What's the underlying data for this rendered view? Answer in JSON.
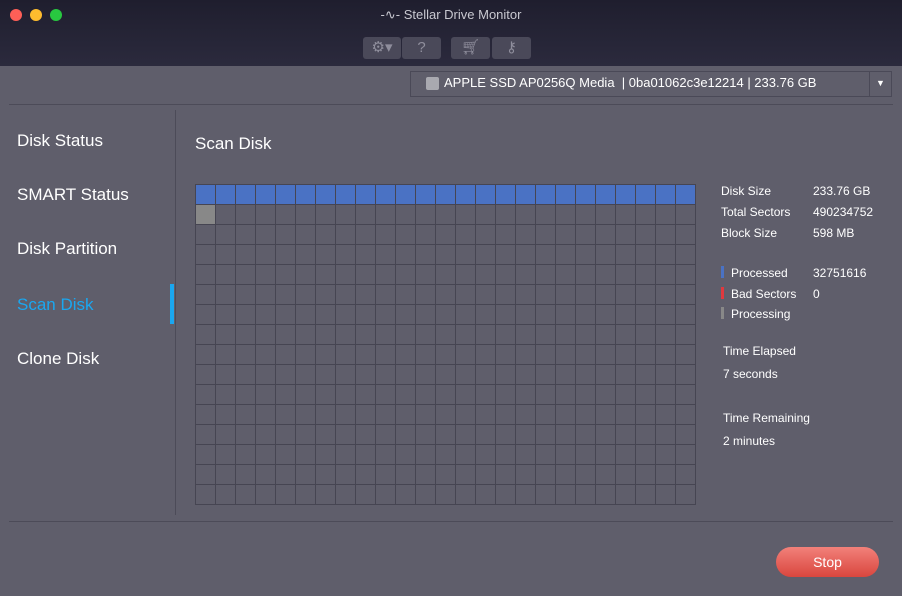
{
  "window": {
    "title": "Stellar Drive Monitor"
  },
  "toolbar": {
    "icons": [
      "gear-icon",
      "help-icon",
      "cart-icon",
      "key-icon"
    ],
    "help_label": "?"
  },
  "drive_select": {
    "value": "APPLE SSD AP0256Q Media  | 0ba01062c3e12214 | 233.76 GB"
  },
  "sidebar": {
    "items": [
      {
        "label": "Disk Status"
      },
      {
        "label": "SMART Status"
      },
      {
        "label": "Disk Partition"
      },
      {
        "label": "Scan Disk",
        "active": true
      },
      {
        "label": "Clone Disk"
      }
    ]
  },
  "main": {
    "title": "Scan Disk"
  },
  "scan_grid": {
    "columns": 25,
    "rows": 16,
    "processed_blocks": 25,
    "processing_blocks": 1,
    "colors": {
      "processed": "#4a72c4",
      "bad": "#e0393e",
      "processing": "#888888"
    }
  },
  "info": {
    "disk_size_label": "Disk Size",
    "disk_size": "233.76 GB",
    "total_sectors_label": "Total Sectors",
    "total_sectors": "490234752",
    "block_size_label": "Block Size",
    "block_size": "598 MB",
    "processed_label": "Processed",
    "processed": "32751616",
    "bad_label": "Bad Sectors",
    "bad": "0",
    "processing_label": "Processing",
    "elapsed_label": "Time Elapsed",
    "elapsed": "7 seconds",
    "remaining_label": "Time Remaining",
    "remaining": "2 minutes"
  },
  "footer": {
    "stop_label": "Stop"
  }
}
